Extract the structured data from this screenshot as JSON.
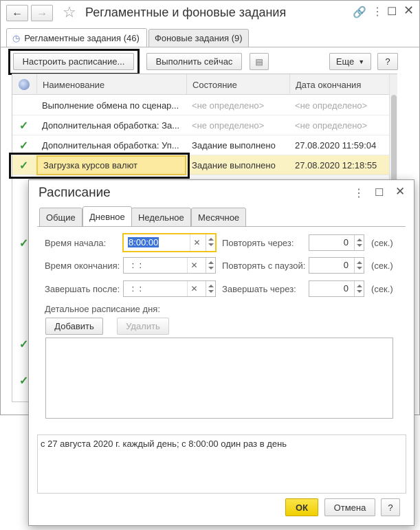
{
  "window": {
    "title": "Регламентные и фоновые задания",
    "tabs": [
      {
        "label": "Регламентные задания (46)",
        "active": true
      },
      {
        "label": "Фоновые задания (9)",
        "active": false
      }
    ],
    "toolbar": {
      "configure_label": "Настроить расписание...",
      "run_now_label": "Выполнить сейчас",
      "more_label": "Еще",
      "help_label": "?"
    },
    "table": {
      "headers": [
        "Наименование",
        "Состояние",
        "Дата окончания"
      ],
      "rows": [
        {
          "checked": false,
          "name": "Выполнение обмена по сценар...",
          "state": "<не определено>",
          "date": "<не определено>"
        },
        {
          "checked": true,
          "name": "Дополнительная обработка: За...",
          "state": "<не определено>",
          "date": "<не определено>"
        },
        {
          "checked": true,
          "name": "Дополнительная обработка: Уп...",
          "state": "Задание выполнено",
          "date": "27.08.2020 11:59:04"
        },
        {
          "checked": true,
          "name": "Загрузка курсов валют",
          "state": "Задание выполнено",
          "date": "27.08.2020 12:18:55",
          "selected": true
        }
      ]
    }
  },
  "dialog": {
    "title": "Расписание",
    "tabs": [
      "Общие",
      "Дневное",
      "Недельное",
      "Месячное"
    ],
    "active_tab": "Дневное",
    "start_time_label": "Время начала:",
    "start_time_value": "8:00:00",
    "end_time_label": "Время окончания:",
    "end_time_value": " :  : ",
    "finish_after_label": "Завершать после:",
    "finish_after_value": " :  : ",
    "repeat_every_label": "Повторять через:",
    "repeat_every_value": "0",
    "repeat_pause_label": "Повторять с паузой:",
    "repeat_pause_value": "0",
    "finish_in_label": "Завершать через:",
    "finish_in_value": "0",
    "unit": "(сек.)",
    "detail_label": "Детальное расписание дня:",
    "add_label": "Добавить",
    "delete_label": "Удалить",
    "summary": "с 27 августа 2020 г. каждый день; с 8:00:00 один раз в день",
    "ok_label": "ОК",
    "cancel_label": "Отмена",
    "help_label": "?"
  },
  "colors": {
    "selected_row": "#fbf2c4",
    "ok_button": "#f5d90a",
    "check": "#3a9a3a"
  }
}
